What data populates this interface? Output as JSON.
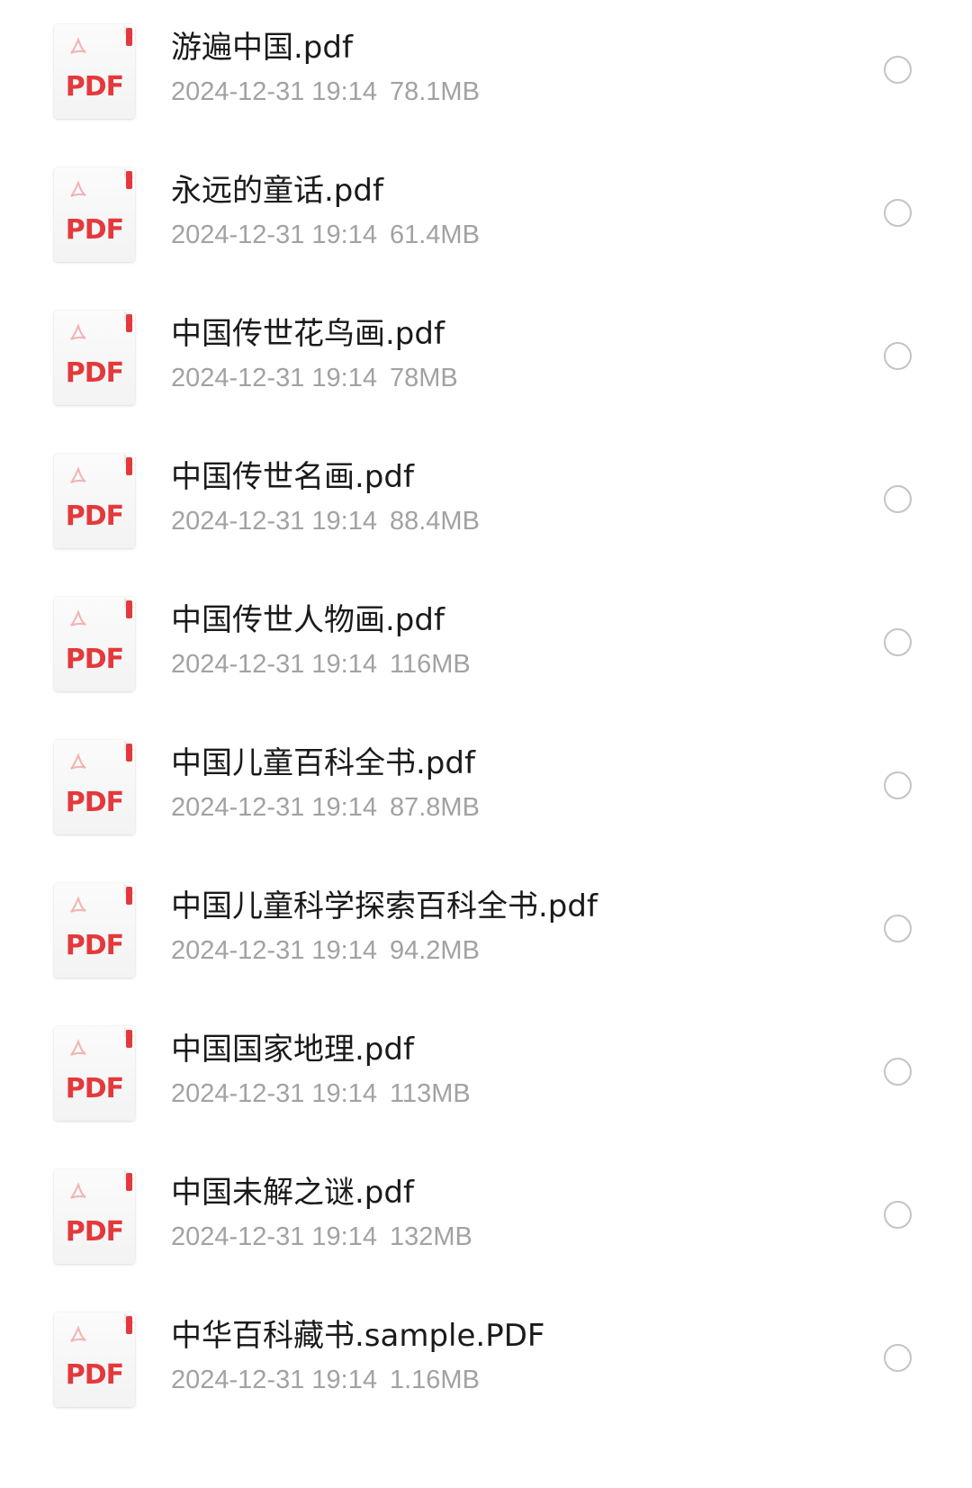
{
  "files": [
    {
      "name": "游遍中国.pdf",
      "date": "2024-12-31 19:14",
      "size": "78.1MB"
    },
    {
      "name": "永远的童话.pdf",
      "date": "2024-12-31 19:14",
      "size": "61.4MB"
    },
    {
      "name": "中国传世花鸟画.pdf",
      "date": "2024-12-31 19:14",
      "size": "78MB"
    },
    {
      "name": "中国传世名画.pdf",
      "date": "2024-12-31 19:14",
      "size": "88.4MB"
    },
    {
      "name": "中国传世人物画.pdf",
      "date": "2024-12-31 19:14",
      "size": "116MB"
    },
    {
      "name": "中国儿童百科全书.pdf",
      "date": "2024-12-31 19:14",
      "size": "87.8MB"
    },
    {
      "name": "中国儿童科学探索百科全书.pdf",
      "date": "2024-12-31 19:14",
      "size": "94.2MB"
    },
    {
      "name": "中国国家地理.pdf",
      "date": "2024-12-31 19:14",
      "size": "113MB"
    },
    {
      "name": "中国未解之谜.pdf",
      "date": "2024-12-31 19:14",
      "size": "132MB"
    },
    {
      "name": "中华百科藏书.sample.PDF",
      "date": "2024-12-31 19:14",
      "size": "1.16MB"
    }
  ],
  "icon": {
    "label": "PDF",
    "name": "pdf-file-icon",
    "accent": "#e4393c"
  }
}
